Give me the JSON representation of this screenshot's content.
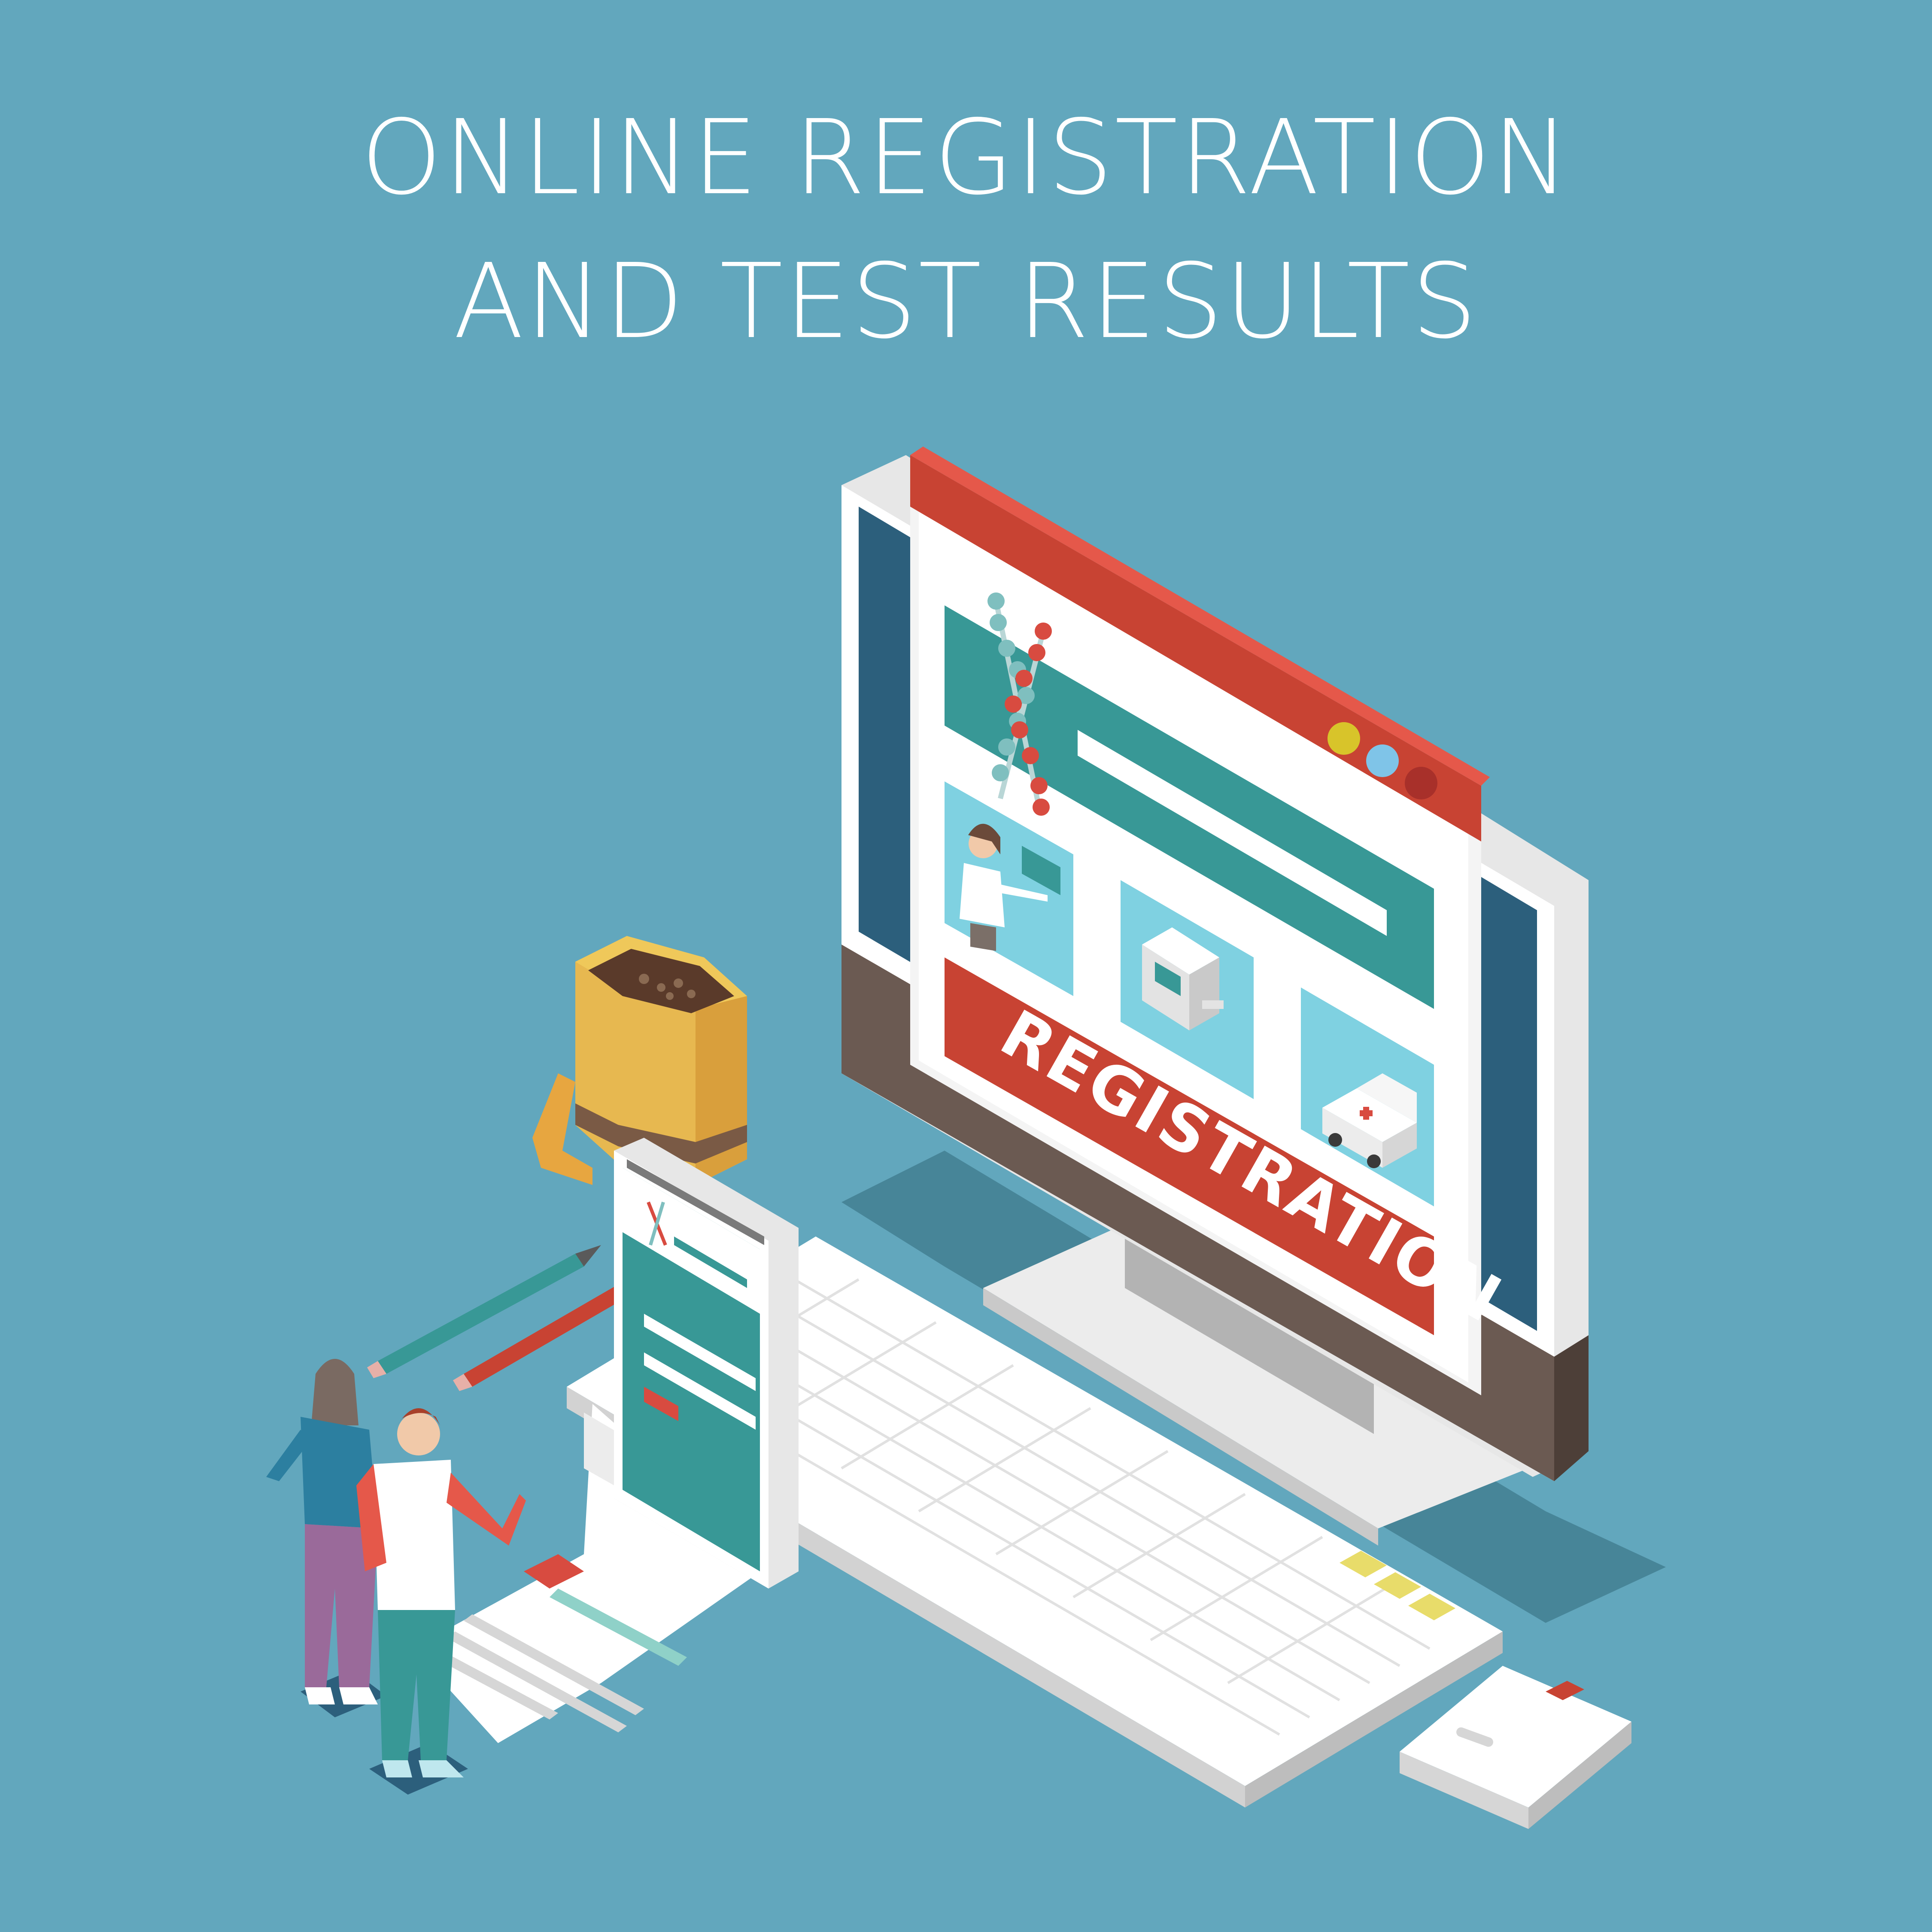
{
  "headline": {
    "line1": "ONLINE REGISTRATION",
    "line2": "AND TEST RESULTS"
  },
  "monitor_screen": {
    "banner_label": "REGISTRATION"
  },
  "icons": [
    "dna-helix-icon",
    "doctor-icon",
    "lab-analyzer-icon",
    "ambulance-icon",
    "coffee-mug-icon",
    "pencil-icon",
    "smartphone-icon",
    "keyboard-icon",
    "mouse-icon"
  ],
  "colors": {
    "background": "#62a7bd",
    "teal": "#389896",
    "red": "#c84333",
    "white": "#ffffff",
    "screen_light_blue": "#7fd1e1"
  }
}
